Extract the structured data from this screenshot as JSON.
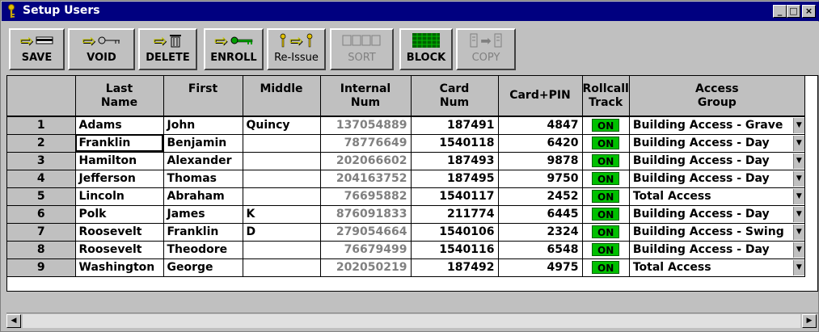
{
  "window": {
    "title": "Setup Users",
    "min_icon": "minimize-icon",
    "max_icon": "maximize-icon",
    "close_icon": "close-icon"
  },
  "toolbar": {
    "save_label": "SAVE",
    "void_label": "VOID",
    "delete_label": "DELETE",
    "enroll_label": "ENROLL",
    "reissue_label": "Re-Issue",
    "sort_label": "SORT",
    "block_label": "BLOCK",
    "copy_label": "COPY"
  },
  "grid": {
    "columns": [
      "Last\nName",
      "First",
      "Middle",
      "Internal\nNum",
      "Card\nNum",
      "Card+PIN",
      "Rollcall\nTrack",
      "Access\nGroup"
    ],
    "headers": {
      "last_name": [
        "Last",
        "Name"
      ],
      "first": "First",
      "middle": "Middle",
      "internal_num": [
        "Internal",
        "Num"
      ],
      "card_num": [
        "Card",
        "Num"
      ],
      "card_pin": "Card+PIN",
      "rollcall_track": [
        "Rollcall",
        "Track"
      ],
      "access_group": [
        "Access",
        "Group"
      ]
    },
    "rows": [
      {
        "num": "1",
        "last": "Adams",
        "first": "John",
        "middle": "Quincy",
        "internal": "137054889",
        "card": "187491",
        "pin": "4847",
        "rollcall": "ON",
        "access": "Building Access - Grave"
      },
      {
        "num": "2",
        "last": "Franklin",
        "first": "Benjamin",
        "middle": "",
        "internal": "78776649",
        "card": "1540118",
        "pin": "6420",
        "rollcall": "ON",
        "access": "Building Access - Day"
      },
      {
        "num": "3",
        "last": "Hamilton",
        "first": "Alexander",
        "middle": "",
        "internal": "202066602",
        "card": "187493",
        "pin": "9878",
        "rollcall": "ON",
        "access": "Building Access - Day"
      },
      {
        "num": "4",
        "last": "Jefferson",
        "first": "Thomas",
        "middle": "",
        "internal": "204163752",
        "card": "187495",
        "pin": "9750",
        "rollcall": "ON",
        "access": "Building Access - Day"
      },
      {
        "num": "5",
        "last": "Lincoln",
        "first": "Abraham",
        "middle": "",
        "internal": "76695882",
        "card": "1540117",
        "pin": "2452",
        "rollcall": "ON",
        "access": "Total Access"
      },
      {
        "num": "6",
        "last": "Polk",
        "first": "James",
        "middle": "K",
        "internal": "876091833",
        "card": "211774",
        "pin": "6445",
        "rollcall": "ON",
        "access": "Building Access - Day"
      },
      {
        "num": "7",
        "last": "Roosevelt",
        "first": "Franklin",
        "middle": "D",
        "internal": "279054664",
        "card": "1540106",
        "pin": "2324",
        "rollcall": "ON",
        "access": "Building Access - Swing"
      },
      {
        "num": "8",
        "last": "Roosevelt",
        "first": "Theodore",
        "middle": "",
        "internal": "76679499",
        "card": "1540116",
        "pin": "6548",
        "rollcall": "ON",
        "access": "Building Access - Day"
      },
      {
        "num": "9",
        "last": "Washington",
        "first": "George",
        "middle": "",
        "internal": "202050219",
        "card": "187492",
        "pin": "4975",
        "rollcall": "ON",
        "access": "Total Access"
      }
    ]
  },
  "colors": {
    "titlebar": "#000080",
    "face": "#c0c0c0",
    "on_badge": "#00c000",
    "internal_num_text": "#808080"
  }
}
